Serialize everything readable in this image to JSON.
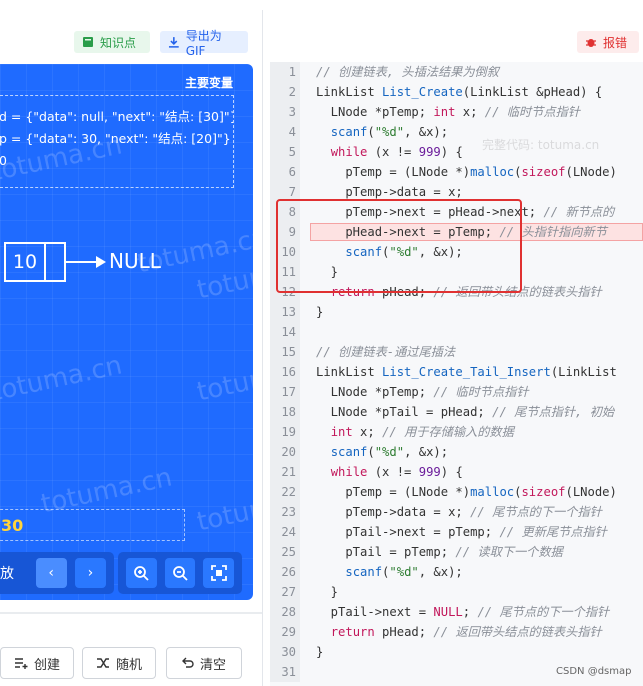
{
  "toolbar": {
    "knowledge_label": "知识点",
    "gif_label": "导出为GIF",
    "report_label": "报错"
  },
  "viz": {
    "title": "主要变量",
    "vars": [
      "d = {\"data\": null, \"next\": \"结点: [30]\"}",
      "p = {\"data\": 30, \"next\": \"结点: [20]\"}",
      "0"
    ],
    "node_value": "10",
    "null_label": "NULL",
    "status_text": "30",
    "watermark": "totuma.cn",
    "play_label": "放",
    "controls": [
      "‹",
      "›"
    ],
    "zoom_in": "+",
    "zoom_out": "−",
    "fit": "⊞"
  },
  "bottom_buttons": {
    "create": "创建",
    "random": "随机",
    "clear": "清空"
  },
  "code_watermark": "完整代码: totuma.cn",
  "csdn_mark": "CSDN @dsmap",
  "code_lines": [
    {
      "n": "1",
      "t": "// 创建链表, 头插法结果为倒叙"
    },
    {
      "n": "2",
      "t": "LinkList List_Create(LinkList &pHead) {"
    },
    {
      "n": "3",
      "t": "  LNode *pTemp; int x; // 临时节点指针"
    },
    {
      "n": "4",
      "t": "  scanf(\"%d\", &x);"
    },
    {
      "n": "5",
      "t": "  while (x != 999) {"
    },
    {
      "n": "6",
      "t": "    pTemp = (LNode *)malloc(sizeof(LNode)"
    },
    {
      "n": "7",
      "t": "    pTemp->data = x;"
    },
    {
      "n": "8",
      "t": "    pTemp->next = pHead->next; // 新节点的"
    },
    {
      "n": "9",
      "t": "    pHead->next = pTemp; // 头指针指向新节"
    },
    {
      "n": "10",
      "t": "    scanf(\"%d\", &x);"
    },
    {
      "n": "11",
      "t": "  }"
    },
    {
      "n": "12",
      "t": "  return pHead; // 返回带头结点的链表头指针"
    },
    {
      "n": "13",
      "t": "}"
    },
    {
      "n": "14",
      "t": ""
    },
    {
      "n": "15",
      "t": "// 创建链表-通过尾插法"
    },
    {
      "n": "16",
      "t": "LinkList List_Create_Tail_Insert(LinkList"
    },
    {
      "n": "17",
      "t": "  LNode *pTemp; // 临时节点指针"
    },
    {
      "n": "18",
      "t": "  LNode *pTail = pHead; // 尾节点指针, 初始"
    },
    {
      "n": "19",
      "t": "  int x; // 用于存储输入的数据"
    },
    {
      "n": "20",
      "t": "  scanf(\"%d\", &x);"
    },
    {
      "n": "21",
      "t": "  while (x != 999) {"
    },
    {
      "n": "22",
      "t": "    pTemp = (LNode *)malloc(sizeof(LNode)"
    },
    {
      "n": "23",
      "t": "    pTemp->data = x; // 尾节点的下一个指针"
    },
    {
      "n": "24",
      "t": "    pTail->next = pTemp; // 更新尾节点指针"
    },
    {
      "n": "25",
      "t": "    pTail = pTemp; // 读取下一个数据"
    },
    {
      "n": "26",
      "t": "    scanf(\"%d\", &x);"
    },
    {
      "n": "27",
      "t": "  }"
    },
    {
      "n": "28",
      "t": "  pTail->next = NULL; // 尾节点的下一个指针"
    },
    {
      "n": "29",
      "t": "  return pHead; // 返回带头结点的链表头指针"
    },
    {
      "n": "30",
      "t": "}"
    },
    {
      "n": "31",
      "t": ""
    }
  ],
  "highlight_line": "9"
}
